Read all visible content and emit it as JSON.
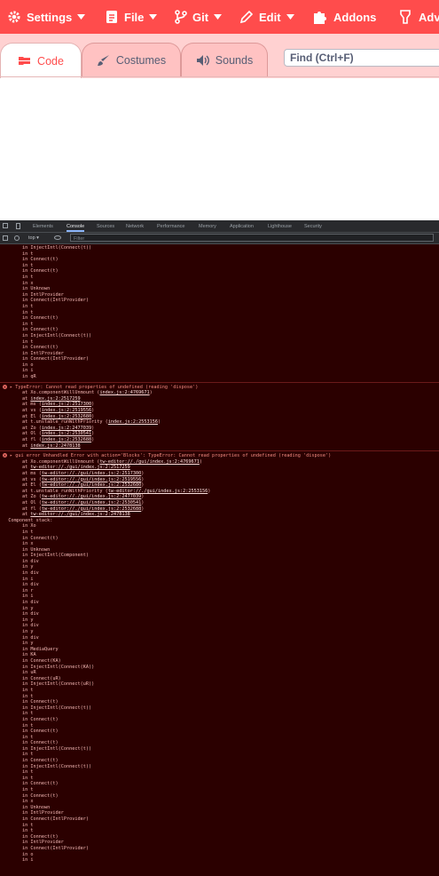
{
  "menubar": {
    "items": [
      {
        "label": "Settings",
        "icon": "gear-icon",
        "has_caret": true
      },
      {
        "label": "File",
        "icon": "file-icon",
        "has_caret": true
      },
      {
        "label": "Git",
        "icon": "git-branch-icon",
        "has_caret": true
      },
      {
        "label": "Edit",
        "icon": "pencil-icon",
        "has_caret": true
      },
      {
        "label": "Addons",
        "icon": "puzzle-icon",
        "has_caret": false
      },
      {
        "label": "Adva",
        "icon": "advanced-icon",
        "has_caret": false
      }
    ]
  },
  "tabs": [
    {
      "label": "Code",
      "icon": "code-blocks-icon",
      "active": true
    },
    {
      "label": "Costumes",
      "icon": "brush-icon",
      "active": false
    },
    {
      "label": "Sounds",
      "icon": "speaker-icon",
      "active": false
    }
  ],
  "find": {
    "placeholder": "Find (Ctrl+F)"
  },
  "devtools": {
    "tabs": [
      "Elements",
      "Console",
      "Sources",
      "Network",
      "Performance",
      "Memory",
      "Application",
      "Lighthouse",
      "Security"
    ],
    "active_tab": "Console",
    "toolbar": {
      "context": "top",
      "filter_placeholder": "Filter"
    }
  },
  "colors": {
    "menubar": "#ff4c4c",
    "tabs_bg": "#ffd1d1",
    "active_tab_text": "#ff4c4c",
    "console_bg": "#2b0000",
    "console_text": "#f2b8b5"
  },
  "console": {
    "pre_stack": [
      "in InjectIntl(Connect(t))",
      "in t",
      "in Connect(t)",
      "in t",
      "in Connect(t)",
      "in t",
      "in x",
      "in Unknown",
      "in IntlProvider",
      "in Connect(IntlProvider)",
      "in t",
      "in t",
      "in Connect(t)",
      "in t",
      "in Connect(t)",
      "in InjectIntl(Connect(t))",
      "in t",
      "in Connect(t)",
      "in IntlProvider",
      "in Connect(IntlProvider)",
      "in o",
      "in i",
      "in qR"
    ],
    "error1": {
      "message": "TypeError: Cannot read properties of undefined (reading 'dispose')",
      "frames": [
        {
          "text": "at Xo.componentWillUnmount (",
          "link": "index.js:2:4769671",
          "end": ")"
        },
        {
          "text": "at ",
          "link": "index.js:2:2517259",
          "end": ""
        },
        {
          "text": "at ms (",
          "link": "index.js:2:2517300",
          "end": ")"
        },
        {
          "text": "at vs (",
          "link": "index.js:2:2519556",
          "end": ")"
        },
        {
          "text": "at El (",
          "link": "index.js:2:2532680",
          "end": ")"
        },
        {
          "text": "at t.unstable_runWithPriority (",
          "link": "index.js:2:2553156",
          "end": ")"
        },
        {
          "text": "at Zo (",
          "link": "index.js:2:2477039",
          "end": ")"
        },
        {
          "text": "at Ol (",
          "link": "index.js:2:2530541",
          "end": ")"
        },
        {
          "text": "at fl (",
          "link": "index.js:2:2532688",
          "end": ")"
        },
        {
          "text": "at ",
          "link": "index.js:2:2478138",
          "end": ""
        }
      ]
    },
    "error2": {
      "message": "gui error Unhandled Error with action='Blocks': TypeError: Cannot read properties of undefined (reading 'dispose')",
      "frames": [
        {
          "text": "at Xo.componentWillUnmount (",
          "link": "tw-editor://./gui/index.js:2:4769671",
          "end": ")"
        },
        {
          "text": "at ",
          "link": "tw-editor://./gui/index.js:2:2517259",
          "end": ""
        },
        {
          "text": "at ms (",
          "link": "tw-editor://./gui/index.js:2:2517300",
          "end": ")"
        },
        {
          "text": "at vs (",
          "link": "tw-editor://./gui/index.js:2:2519556",
          "end": ")"
        },
        {
          "text": "at El (",
          "link": "tw-editor://./gui/index.js:2:2532680",
          "end": ")"
        },
        {
          "text": "at t.unstable_runWithPriority (",
          "link": "tw-editor://./gui/index.js:2:2553156",
          "end": ")"
        },
        {
          "text": "at Zo (",
          "link": "tw-editor://./gui/index.js:2:2477039",
          "end": ")"
        },
        {
          "text": "at Ol (",
          "link": "tw-editor://./gui/index.js:2:2530541",
          "end": ")"
        },
        {
          "text": "at fl (",
          "link": "tw-editor://./gui/index.js:2:2532688",
          "end": ")"
        },
        {
          "text": "at ",
          "link": "tw-editor://./gui/index.js:2:2478138",
          "end": ""
        }
      ],
      "component_stack_label": "Component stack:",
      "component_stack": [
        "in Xo",
        "in t",
        "in Connect(t)",
        "in x",
        "in Unknown",
        "in InjectIntl(Component)",
        "in div",
        "in y",
        "in div",
        "in i",
        "in div",
        "in r",
        "in i",
        "in div",
        "in y",
        "in div",
        "in y",
        "in div",
        "in y",
        "in div",
        "in y",
        "in MediaQuery",
        "in KA",
        "in Connect(KA)",
        "in InjectIntl(Connect(KA))",
        "in uR",
        "in Connect(uR)",
        "in InjectIntl(Connect(uR))",
        "in t",
        "in t",
        "in Connect(t)",
        "in InjectIntl(Connect(t))",
        "in t",
        "in Connect(t)",
        "in t",
        "in Connect(t)",
        "in t",
        "in Connect(t)",
        "in InjectIntl(Connect(t))",
        "in t",
        "in Connect(t)",
        "in InjectIntl(Connect(t))",
        "in t",
        "in t",
        "in Connect(t)",
        "in t",
        "in Connect(t)",
        "in x",
        "in Unknown",
        "in IntlProvider",
        "in Connect(IntlProvider)",
        "in t",
        "in t",
        "in Connect(t)",
        "in IntlProvider",
        "in Connect(IntlProvider)",
        "in o",
        "in i"
      ]
    }
  }
}
